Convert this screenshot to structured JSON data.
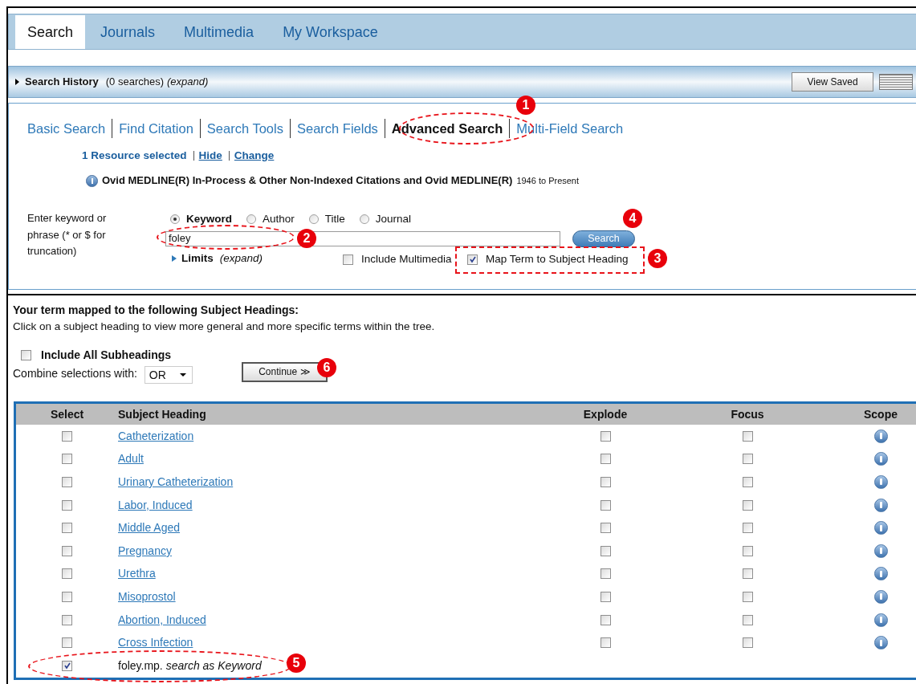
{
  "tabs": [
    {
      "label": "Search",
      "selected": true
    },
    {
      "label": "Journals",
      "selected": false
    },
    {
      "label": "Multimedia",
      "selected": false
    },
    {
      "label": "My Workspace",
      "selected": false
    }
  ],
  "search_history": {
    "label": "Search History",
    "count": "(0 searches)",
    "expand": "(expand)",
    "button": "View Saved"
  },
  "search_modes": [
    {
      "label": "Basic Search",
      "selected": false
    },
    {
      "label": "Find Citation",
      "selected": false
    },
    {
      "label": "Search Tools",
      "selected": false
    },
    {
      "label": "Search Fields",
      "selected": false
    },
    {
      "label": "Advanced Search",
      "selected": true
    },
    {
      "label": "Multi-Field Search",
      "selected": false
    }
  ],
  "resources": {
    "selected": "1 Resource selected",
    "hide": "Hide",
    "change": "Change"
  },
  "database": {
    "name": "Ovid MEDLINE(R) In-Process & Other Non-Indexed Citations and Ovid MEDLINE(R)",
    "range": "1946 to Present"
  },
  "search_form": {
    "prompt": "Enter keyword or phrase (* or $ for truncation)",
    "field_types": [
      {
        "label": "Keyword",
        "selected": true
      },
      {
        "label": "Author",
        "selected": false
      },
      {
        "label": "Title",
        "selected": false
      },
      {
        "label": "Journal",
        "selected": false
      }
    ],
    "query": "foley",
    "search_button": "Search",
    "limits": "Limits",
    "limits_expand": "(expand)",
    "options": [
      {
        "label": "Include Multimedia",
        "checked": false
      },
      {
        "label": "Map Term to Subject Heading",
        "checked": true
      }
    ]
  },
  "mapping": {
    "title": "Your term mapped to the following Subject Headings:",
    "hint": "Click on a subject heading to view more general and more specific terms within the tree.",
    "include_subheadings": {
      "label": "Include All Subheadings",
      "checked": false
    },
    "combine_label": "Combine selections with:",
    "combine_value": "OR",
    "continue_button": "Continue ≫"
  },
  "table": {
    "columns": [
      "Select",
      "Subject Heading",
      "Explode",
      "Focus",
      "Scope"
    ],
    "rows": [
      {
        "kind": "heading",
        "heading": "Catheterization",
        "selected": false,
        "explode": false,
        "focus": false
      },
      {
        "kind": "heading",
        "heading": "Adult",
        "selected": false,
        "explode": false,
        "focus": false
      },
      {
        "kind": "heading",
        "heading": "Urinary Catheterization",
        "selected": false,
        "explode": false,
        "focus": false
      },
      {
        "kind": "heading",
        "heading": "Labor, Induced",
        "selected": false,
        "explode": false,
        "focus": false
      },
      {
        "kind": "heading",
        "heading": "Middle Aged",
        "selected": false,
        "explode": false,
        "focus": false
      },
      {
        "kind": "heading",
        "heading": "Pregnancy",
        "selected": false,
        "explode": false,
        "focus": false
      },
      {
        "kind": "heading",
        "heading": "Urethra",
        "selected": false,
        "explode": false,
        "focus": false
      },
      {
        "kind": "heading",
        "heading": "Misoprostol",
        "selected": false,
        "explode": false,
        "focus": false
      },
      {
        "kind": "heading",
        "heading": "Abortion, Induced",
        "selected": false,
        "explode": false,
        "focus": false
      },
      {
        "kind": "heading",
        "heading": "Cross Infection",
        "selected": false,
        "explode": false,
        "focus": false
      },
      {
        "kind": "keyword",
        "term": "foley.mp.",
        "note": "search as Keyword",
        "selected": true
      }
    ]
  },
  "callouts": [
    {
      "number": "1",
      "kind": "ellipse"
    },
    {
      "number": "2",
      "kind": "ellipse"
    },
    {
      "number": "3",
      "kind": "rect"
    },
    {
      "number": "4"
    },
    {
      "number": "5",
      "kind": "ellipse"
    },
    {
      "number": "6"
    }
  ]
}
